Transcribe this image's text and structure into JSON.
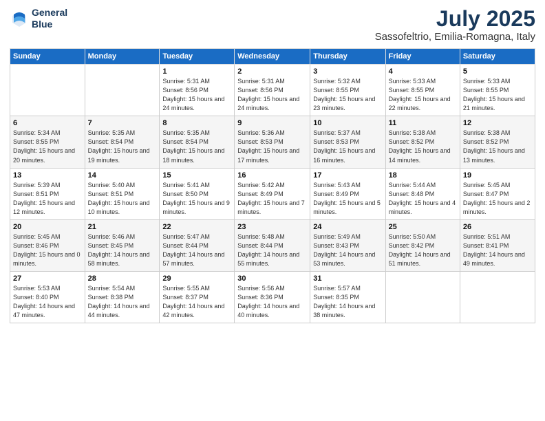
{
  "header": {
    "logo_line1": "General",
    "logo_line2": "Blue",
    "month": "July 2025",
    "location": "Sassofeltrio, Emilia-Romagna, Italy"
  },
  "weekdays": [
    "Sunday",
    "Monday",
    "Tuesday",
    "Wednesday",
    "Thursday",
    "Friday",
    "Saturday"
  ],
  "weeks": [
    [
      {
        "day": "",
        "info": ""
      },
      {
        "day": "",
        "info": ""
      },
      {
        "day": "1",
        "info": "Sunrise: 5:31 AM\nSunset: 8:56 PM\nDaylight: 15 hours\nand 24 minutes."
      },
      {
        "day": "2",
        "info": "Sunrise: 5:31 AM\nSunset: 8:56 PM\nDaylight: 15 hours\nand 24 minutes."
      },
      {
        "day": "3",
        "info": "Sunrise: 5:32 AM\nSunset: 8:55 PM\nDaylight: 15 hours\nand 23 minutes."
      },
      {
        "day": "4",
        "info": "Sunrise: 5:33 AM\nSunset: 8:55 PM\nDaylight: 15 hours\nand 22 minutes."
      },
      {
        "day": "5",
        "info": "Sunrise: 5:33 AM\nSunset: 8:55 PM\nDaylight: 15 hours\nand 21 minutes."
      }
    ],
    [
      {
        "day": "6",
        "info": "Sunrise: 5:34 AM\nSunset: 8:55 PM\nDaylight: 15 hours\nand 20 minutes."
      },
      {
        "day": "7",
        "info": "Sunrise: 5:35 AM\nSunset: 8:54 PM\nDaylight: 15 hours\nand 19 minutes."
      },
      {
        "day": "8",
        "info": "Sunrise: 5:35 AM\nSunset: 8:54 PM\nDaylight: 15 hours\nand 18 minutes."
      },
      {
        "day": "9",
        "info": "Sunrise: 5:36 AM\nSunset: 8:53 PM\nDaylight: 15 hours\nand 17 minutes."
      },
      {
        "day": "10",
        "info": "Sunrise: 5:37 AM\nSunset: 8:53 PM\nDaylight: 15 hours\nand 16 minutes."
      },
      {
        "day": "11",
        "info": "Sunrise: 5:38 AM\nSunset: 8:52 PM\nDaylight: 15 hours\nand 14 minutes."
      },
      {
        "day": "12",
        "info": "Sunrise: 5:38 AM\nSunset: 8:52 PM\nDaylight: 15 hours\nand 13 minutes."
      }
    ],
    [
      {
        "day": "13",
        "info": "Sunrise: 5:39 AM\nSunset: 8:51 PM\nDaylight: 15 hours\nand 12 minutes."
      },
      {
        "day": "14",
        "info": "Sunrise: 5:40 AM\nSunset: 8:51 PM\nDaylight: 15 hours\nand 10 minutes."
      },
      {
        "day": "15",
        "info": "Sunrise: 5:41 AM\nSunset: 8:50 PM\nDaylight: 15 hours\nand 9 minutes."
      },
      {
        "day": "16",
        "info": "Sunrise: 5:42 AM\nSunset: 8:49 PM\nDaylight: 15 hours\nand 7 minutes."
      },
      {
        "day": "17",
        "info": "Sunrise: 5:43 AM\nSunset: 8:49 PM\nDaylight: 15 hours\nand 5 minutes."
      },
      {
        "day": "18",
        "info": "Sunrise: 5:44 AM\nSunset: 8:48 PM\nDaylight: 15 hours\nand 4 minutes."
      },
      {
        "day": "19",
        "info": "Sunrise: 5:45 AM\nSunset: 8:47 PM\nDaylight: 15 hours\nand 2 minutes."
      }
    ],
    [
      {
        "day": "20",
        "info": "Sunrise: 5:45 AM\nSunset: 8:46 PM\nDaylight: 15 hours\nand 0 minutes."
      },
      {
        "day": "21",
        "info": "Sunrise: 5:46 AM\nSunset: 8:45 PM\nDaylight: 14 hours\nand 58 minutes."
      },
      {
        "day": "22",
        "info": "Sunrise: 5:47 AM\nSunset: 8:44 PM\nDaylight: 14 hours\nand 57 minutes."
      },
      {
        "day": "23",
        "info": "Sunrise: 5:48 AM\nSunset: 8:44 PM\nDaylight: 14 hours\nand 55 minutes."
      },
      {
        "day": "24",
        "info": "Sunrise: 5:49 AM\nSunset: 8:43 PM\nDaylight: 14 hours\nand 53 minutes."
      },
      {
        "day": "25",
        "info": "Sunrise: 5:50 AM\nSunset: 8:42 PM\nDaylight: 14 hours\nand 51 minutes."
      },
      {
        "day": "26",
        "info": "Sunrise: 5:51 AM\nSunset: 8:41 PM\nDaylight: 14 hours\nand 49 minutes."
      }
    ],
    [
      {
        "day": "27",
        "info": "Sunrise: 5:53 AM\nSunset: 8:40 PM\nDaylight: 14 hours\nand 47 minutes."
      },
      {
        "day": "28",
        "info": "Sunrise: 5:54 AM\nSunset: 8:38 PM\nDaylight: 14 hours\nand 44 minutes."
      },
      {
        "day": "29",
        "info": "Sunrise: 5:55 AM\nSunset: 8:37 PM\nDaylight: 14 hours\nand 42 minutes."
      },
      {
        "day": "30",
        "info": "Sunrise: 5:56 AM\nSunset: 8:36 PM\nDaylight: 14 hours\nand 40 minutes."
      },
      {
        "day": "31",
        "info": "Sunrise: 5:57 AM\nSunset: 8:35 PM\nDaylight: 14 hours\nand 38 minutes."
      },
      {
        "day": "",
        "info": ""
      },
      {
        "day": "",
        "info": ""
      }
    ]
  ]
}
